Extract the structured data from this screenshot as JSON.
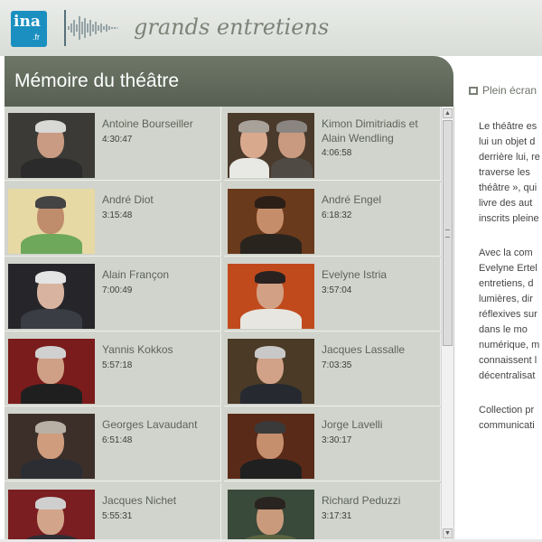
{
  "header": {
    "logo_main": "ina",
    "logo_sub": ".fr",
    "site_title": "grands entretiens"
  },
  "page_title": "Mémoire du théâtre",
  "fullscreen_label": "Plein écran",
  "interviews": [
    {
      "name": "Antoine Bourseiller",
      "duration": "4:30:47"
    },
    {
      "name": "Kimon Dimitriadis et Alain Wendling",
      "duration": "4:06:58"
    },
    {
      "name": "André Diot",
      "duration": "3:15:48"
    },
    {
      "name": "André Engel",
      "duration": "6:18:32"
    },
    {
      "name": "Alain Françon",
      "duration": "7:00:49"
    },
    {
      "name": "Evelyne Istria",
      "duration": "3:57:04"
    },
    {
      "name": "Yannis Kokkos",
      "duration": "5:57:18"
    },
    {
      "name": "Jacques Lassalle",
      "duration": "7:03:35"
    },
    {
      "name": "Georges Lavaudant",
      "duration": "6:51:48"
    },
    {
      "name": "Jorge Lavelli",
      "duration": "3:30:17"
    },
    {
      "name": "Jacques Nichet",
      "duration": "5:55:31"
    },
    {
      "name": "Richard Peduzzi",
      "duration": "3:17:31"
    }
  ],
  "description": {
    "para1": [
      "Le théâtre es",
      "lui un objet d",
      "derrière lui, re",
      "traverse les",
      "théâtre », qui",
      "livre des aut",
      "inscrits pleine"
    ],
    "para2": [
      "Avec la com",
      "Evelyne Ertel",
      "entretiens, d",
      "lumières, dir",
      "réflexives sur",
      "dans le mo",
      "numérique, m",
      "connaissent l",
      "décentralisat"
    ],
    "para3": [
      "Collection pr",
      "communicati"
    ]
  },
  "colors": {
    "title_bar": "#5f6859",
    "grid_bg": "#d1d4cc",
    "name_text": "#5d6357",
    "logo_bg": "#1a8fc0"
  }
}
